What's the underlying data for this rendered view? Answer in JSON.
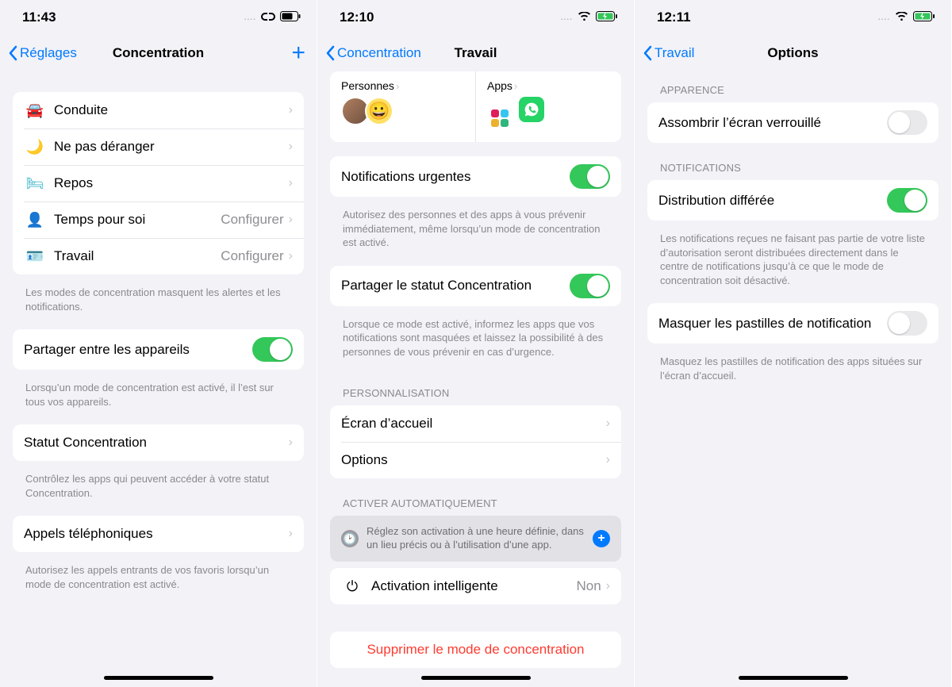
{
  "col1": {
    "time": "11:43",
    "back": "Réglages",
    "title": "Concentration",
    "modes": [
      {
        "label": "Conduite",
        "icon": "🚘",
        "icon_class": "ic-car",
        "detail": ""
      },
      {
        "label": "Ne pas déranger",
        "icon": "🌙",
        "icon_class": "ic-moon",
        "detail": ""
      },
      {
        "label": "Repos",
        "icon": "🛏",
        "icon_class": "ic-bed",
        "detail": ""
      },
      {
        "label": "Temps pour soi",
        "icon": "👤",
        "icon_class": "ic-person",
        "detail": "Configurer"
      },
      {
        "label": "Travail",
        "icon": "🪪",
        "icon_class": "ic-badge",
        "detail": "Configurer"
      }
    ],
    "modes_footer": "Les modes de concentration masquent les alertes et les notifications.",
    "share_devices": {
      "label": "Partager entre les appareils",
      "on": true,
      "footer": "Lorsqu’un mode de concentration est activé, il l’est sur tous vos appareils."
    },
    "status_row": {
      "label": "Statut Concentration",
      "footer": "Contrôlez les apps qui peuvent accéder à votre statut Concentration."
    },
    "calls_row": {
      "label": "Appels téléphoniques",
      "footer": "Autorisez les appels entrants de vos favoris lorsqu’un mode de concentration est activé."
    }
  },
  "col2": {
    "time": "12:10",
    "back": "Concentration",
    "title": "Travail",
    "pa": {
      "people_label": "Personnes",
      "apps_label": "Apps"
    },
    "urgent": {
      "label": "Notifications urgentes",
      "on": true,
      "footer": "Autorisez des personnes et des apps à vous prévenir immédiatement, même lorsqu’un mode de concentration est activé."
    },
    "share_status": {
      "label": "Partager le statut Concentration",
      "on": true,
      "footer": "Lorsque ce mode est activé, informez les apps que vos notifications sont masquées et laissez la possibilité à des personnes de vous prévenir en cas d’urgence."
    },
    "personnalisation_header": "PERSONNALISATION",
    "home_row": "Écran d’accueil",
    "options_row": "Options",
    "auto_header": "ACTIVER AUTOMATIQUEMENT",
    "auto_hint": "Réglez son activation à une heure définie, dans un lieu précis ou à l’utilisation d’une app.",
    "smart": {
      "label": "Activation intelligente",
      "value": "Non"
    },
    "delete": "Supprimer le mode de concentration"
  },
  "col3": {
    "time": "12:11",
    "back": "Travail",
    "title": "Options",
    "appearance_header": "APPARENCE",
    "dim": {
      "label": "Assombrir l’écran verrouillé",
      "on": false
    },
    "notifs_header": "NOTIFICATIONS",
    "delayed": {
      "label": "Distribution différée",
      "on": true,
      "footer": "Les notifications reçues ne faisant pas partie de votre liste d’autorisation seront distribuées directement dans le centre de notifications jusqu’à ce que le mode de concentration soit désactivé."
    },
    "badges": {
      "label": "Masquer les pastilles de notification",
      "on": false,
      "footer": "Masquez les pastilles de notification des apps situées sur l’écran d’accueil."
    }
  }
}
